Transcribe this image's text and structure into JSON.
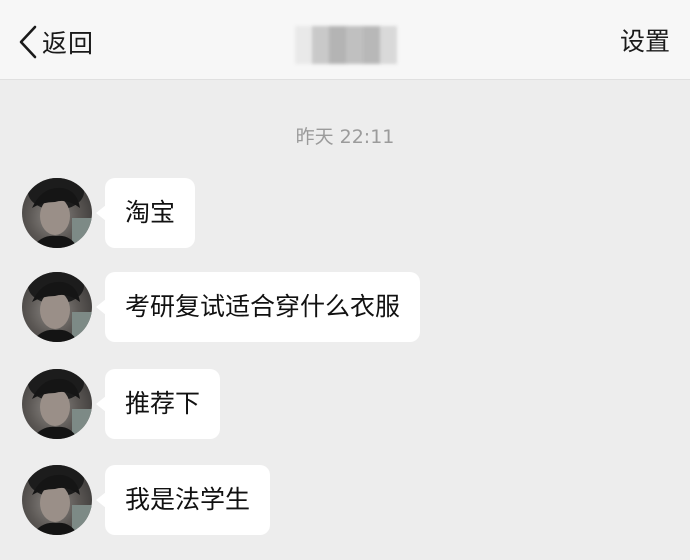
{
  "nav": {
    "back_label": "返回",
    "settings_label": "设置"
  },
  "chat": {
    "timestamp": "昨天 22:11",
    "messages": [
      {
        "text": "淘宝"
      },
      {
        "text": "考研复试适合穿什么衣服"
      },
      {
        "text": "推荐下"
      },
      {
        "text": "我是法学生"
      }
    ]
  },
  "colors": {
    "background": "#ededed",
    "nav_background": "#f7f7f7",
    "bubble": "#ffffff",
    "timestamp_text": "#9b9b9b"
  }
}
